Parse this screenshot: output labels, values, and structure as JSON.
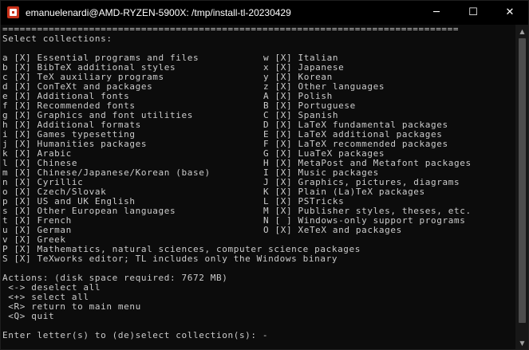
{
  "window": {
    "title": "emanuelenardi@AMD-RYZEN-5900X: /tmp/install-tl-20230429",
    "min_glyph": "─",
    "max_glyph": "☐",
    "close_glyph": "✕"
  },
  "scrollbar": {
    "up_glyph": "▲",
    "down_glyph": "▼"
  },
  "colors": {
    "terminal_bg": "#0c0c0c",
    "terminal_fg": "#cccccc",
    "titlebar_bg": "#000000"
  },
  "terminal": {
    "separator": "===============================================================================",
    "heading": "Select collections:",
    "collections_left": [
      "a [X] Essential programs and files",
      "b [X] BibTeX additional styles",
      "c [X] TeX auxiliary programs",
      "d [X] ConTeXt and packages",
      "e [X] Additional fonts",
      "f [X] Recommended fonts",
      "g [X] Graphics and font utilities",
      "h [X] Additional formats",
      "i [X] Games typesetting",
      "j [X] Humanities packages",
      "k [X] Arabic",
      "l [X] Chinese",
      "m [X] Chinese/Japanese/Korean (base)",
      "n [X] Cyrillic",
      "o [X] Czech/Slovak",
      "p [X] US and UK English",
      "s [X] Other European languages",
      "t [X] French",
      "u [X] German",
      "v [X] Greek"
    ],
    "collections_right": [
      "w [X] Italian",
      "x [X] Japanese",
      "y [X] Korean",
      "z [X] Other languages",
      "A [X] Polish",
      "B [X] Portuguese",
      "C [X] Spanish",
      "D [X] LaTeX fundamental packages",
      "E [X] LaTeX additional packages",
      "F [X] LaTeX recommended packages",
      "G [X] LuaTeX packages",
      "H [X] MetaPost and Metafont packages",
      "I [X] Music packages",
      "J [X] Graphics, pictures, diagrams",
      "K [X] Plain (La)TeX packages",
      "L [X] PSTricks",
      "M [X] Publisher styles, theses, etc.",
      "N [ ] Windows-only support programs",
      "O [X] XeTeX and packages"
    ],
    "collections_full": [
      "P [X] Mathematics, natural sciences, computer science packages",
      "S [X] TeXworks editor; TL includes only the Windows binary"
    ],
    "actions_heading": "Actions: (disk space required: 7672 MB)",
    "actions": [
      " <-> deselect all",
      " <+> select all",
      " <R> return to main menu",
      " <Q> quit"
    ],
    "prompt": "Enter letter(s) to (de)select collection(s): -"
  }
}
